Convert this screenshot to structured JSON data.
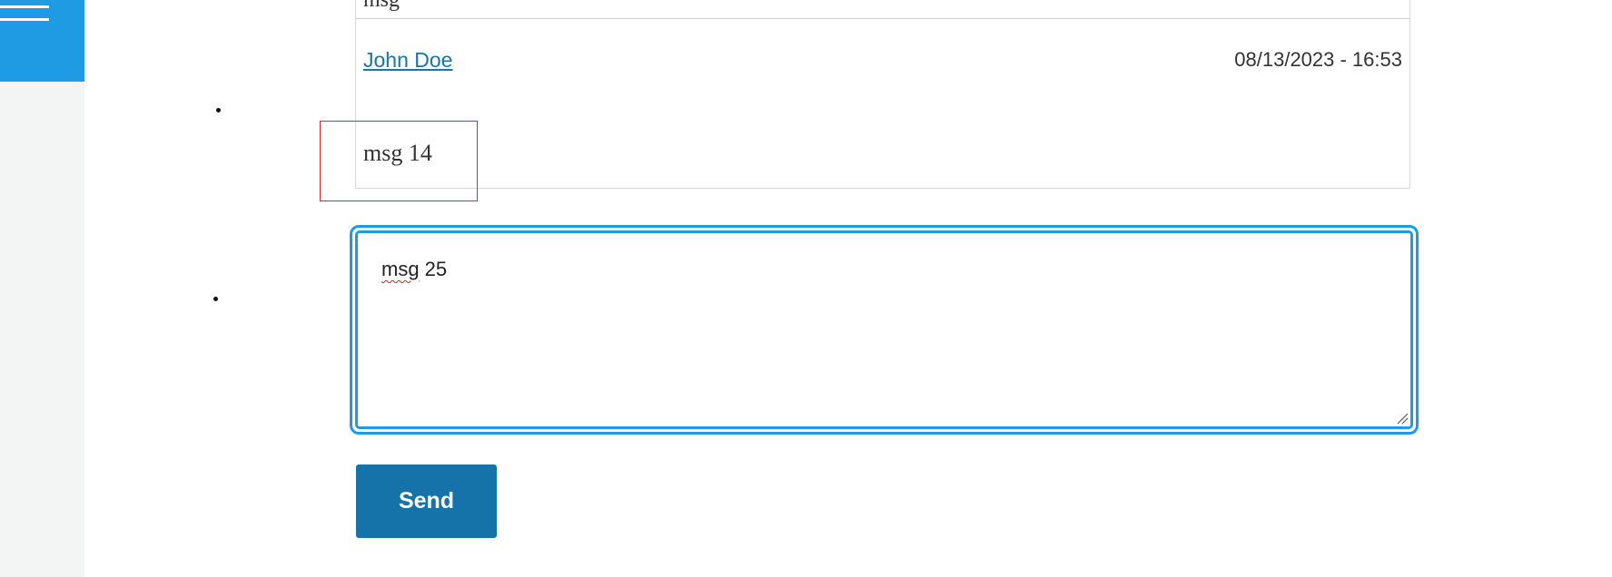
{
  "sidebar": {
    "menu_icon": "hamburger-menu-icon",
    "accent_color": "#1e9be3"
  },
  "messages": {
    "previous_text": "msg",
    "author": "John Doe",
    "timestamp": "08/13/2023 - 16:53",
    "body": "msg 14"
  },
  "composer": {
    "value_word": "msg",
    "value_number": " 25",
    "resize_icon": "resize-handle-icon"
  },
  "actions": {
    "send_label": "Send",
    "send_color": "#1673aa"
  }
}
